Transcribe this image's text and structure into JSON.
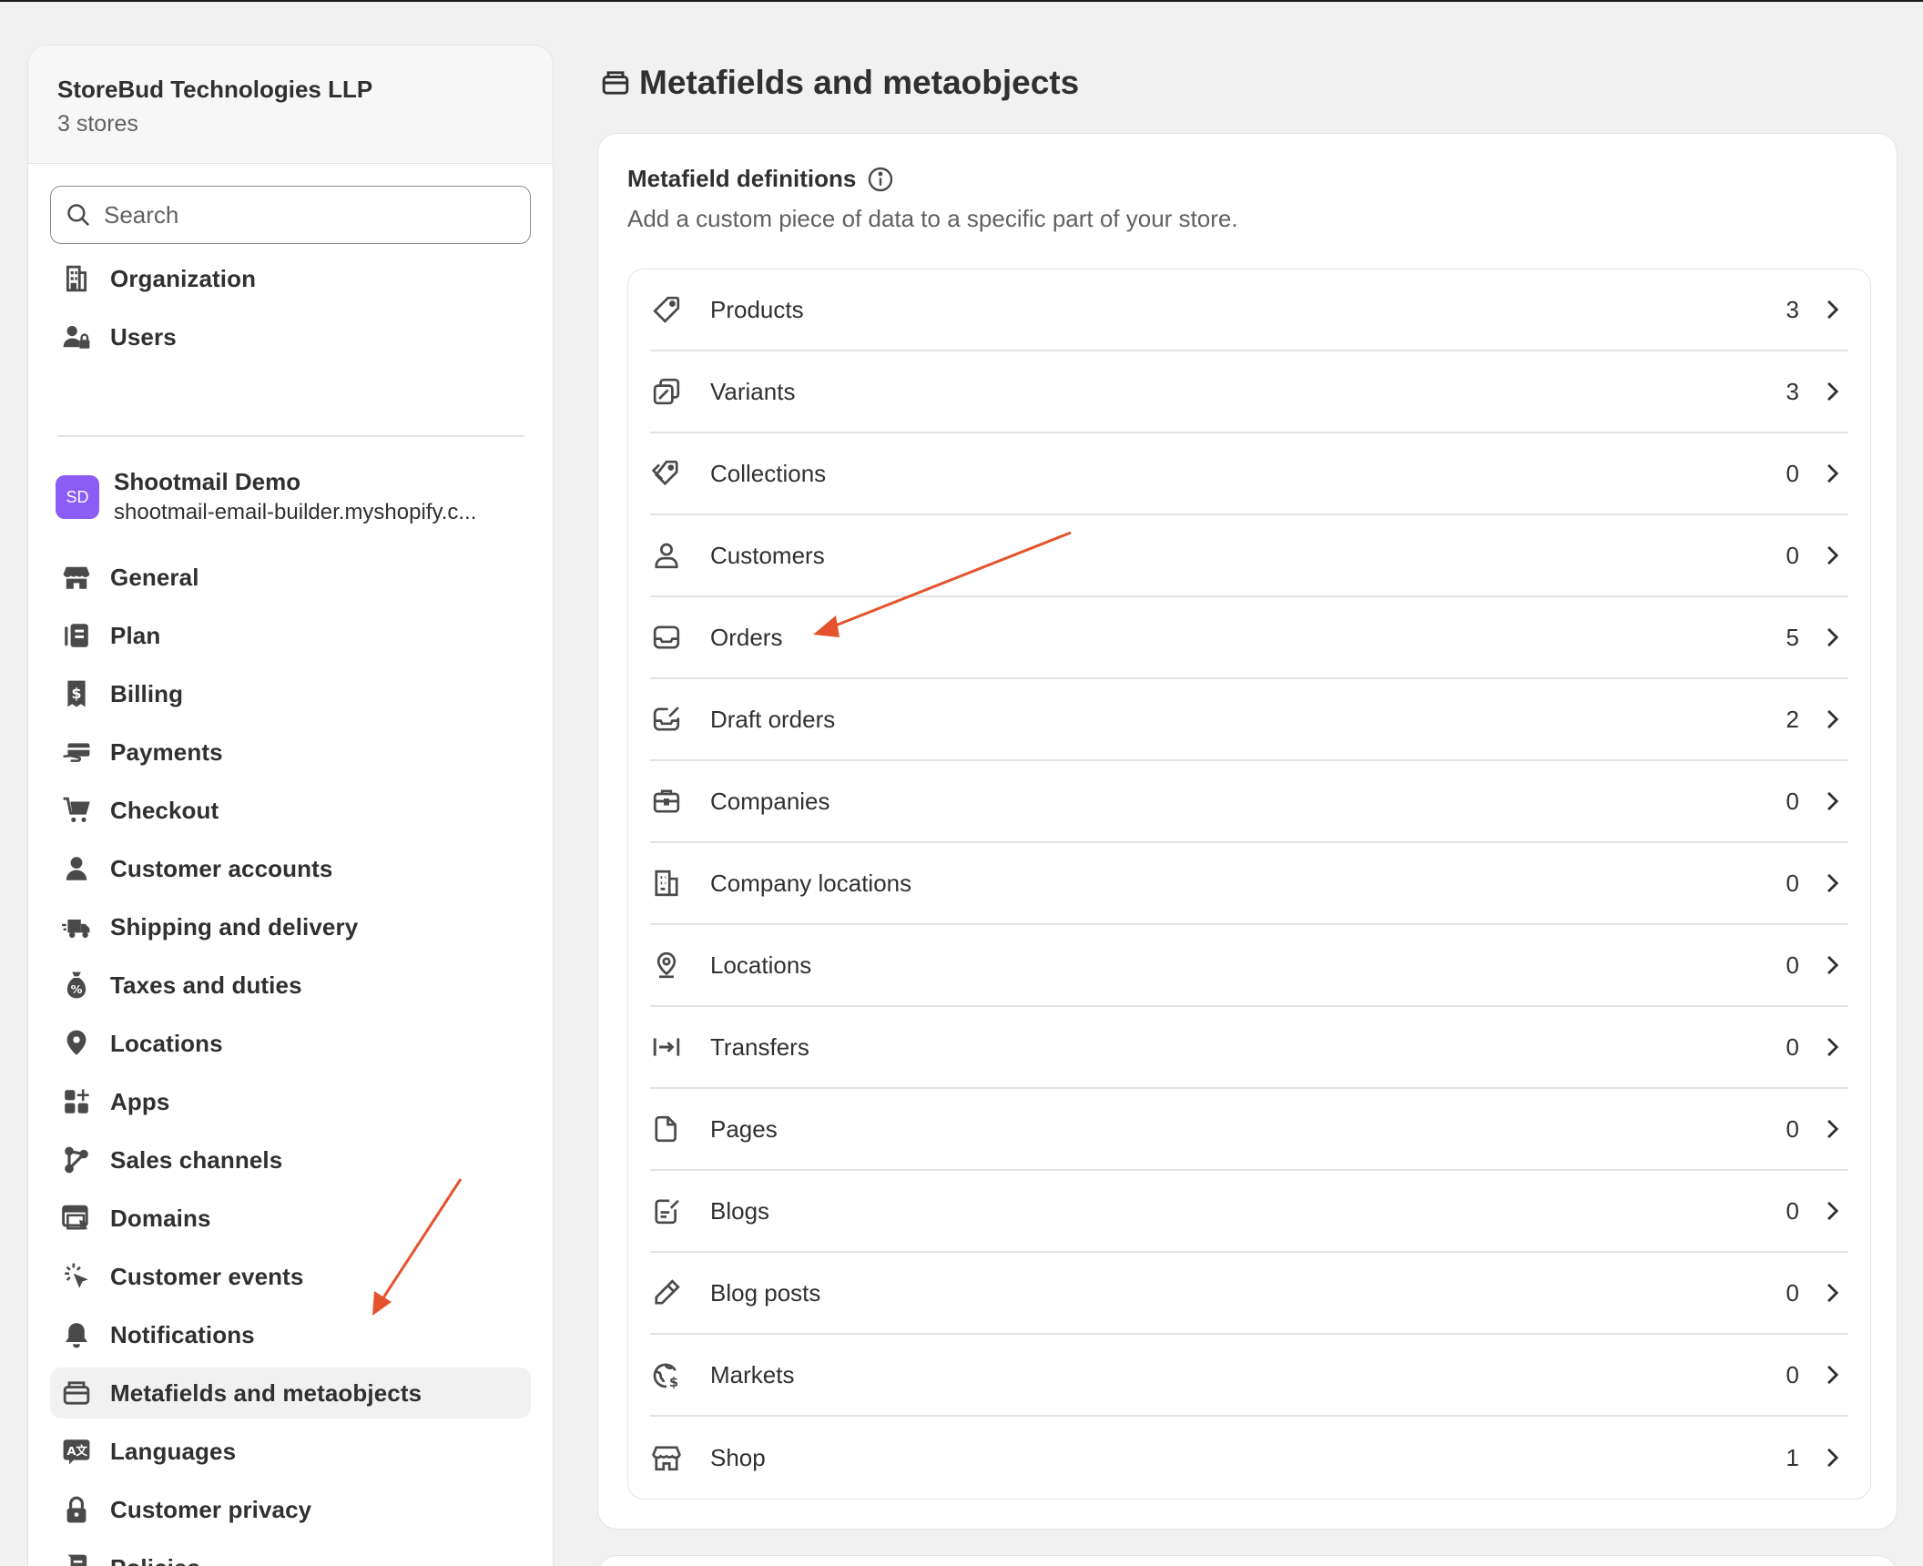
{
  "organization": {
    "name": "StoreBud Technologies LLP",
    "store_count": "3 stores"
  },
  "search": {
    "placeholder": "Search"
  },
  "org_nav": [
    {
      "label": "Organization",
      "icon": "building-icon"
    },
    {
      "label": "Users",
      "icon": "users-icon"
    }
  ],
  "store": {
    "avatar": "SD",
    "name": "Shootmail Demo",
    "domain": "shootmail-email-builder.myshopify.c...",
    "avatar_color": "#8b5cf6"
  },
  "settings_nav": [
    {
      "label": "General",
      "icon": "store-icon"
    },
    {
      "label": "Plan",
      "icon": "plan-icon"
    },
    {
      "label": "Billing",
      "icon": "billing-icon"
    },
    {
      "label": "Payments",
      "icon": "payments-icon"
    },
    {
      "label": "Checkout",
      "icon": "cart-icon"
    },
    {
      "label": "Customer accounts",
      "icon": "person-icon"
    },
    {
      "label": "Shipping and delivery",
      "icon": "truck-icon"
    },
    {
      "label": "Taxes and duties",
      "icon": "tax-icon"
    },
    {
      "label": "Locations",
      "icon": "location-pin-icon"
    },
    {
      "label": "Apps",
      "icon": "apps-icon"
    },
    {
      "label": "Sales channels",
      "icon": "channels-icon"
    },
    {
      "label": "Domains",
      "icon": "domains-icon"
    },
    {
      "label": "Customer events",
      "icon": "cursor-click-icon"
    },
    {
      "label": "Notifications",
      "icon": "bell-icon"
    },
    {
      "label": "Metafields and metaobjects",
      "icon": "metafields-icon",
      "active": true
    },
    {
      "label": "Languages",
      "icon": "language-icon"
    },
    {
      "label": "Customer privacy",
      "icon": "lock-icon"
    },
    {
      "label": "Policies",
      "icon": "policy-icon"
    }
  ],
  "page": {
    "title": "Metafields and metaobjects",
    "section_title": "Metafield definitions",
    "section_description": "Add a custom piece of data to a specific part of your store."
  },
  "definitions": [
    {
      "label": "Products",
      "count": "3",
      "icon": "tag-icon"
    },
    {
      "label": "Variants",
      "count": "3",
      "icon": "variants-icon"
    },
    {
      "label": "Collections",
      "count": "0",
      "icon": "collections-icon"
    },
    {
      "label": "Customers",
      "count": "0",
      "icon": "customer-icon"
    },
    {
      "label": "Orders",
      "count": "5",
      "icon": "inbox-icon"
    },
    {
      "label": "Draft orders",
      "count": "2",
      "icon": "draft-order-icon"
    },
    {
      "label": "Companies",
      "count": "0",
      "icon": "briefcase-icon"
    },
    {
      "label": "Company locations",
      "count": "0",
      "icon": "company-building-icon"
    },
    {
      "label": "Locations",
      "count": "0",
      "icon": "location-icon"
    },
    {
      "label": "Transfers",
      "count": "0",
      "icon": "transfer-icon"
    },
    {
      "label": "Pages",
      "count": "0",
      "icon": "page-icon"
    },
    {
      "label": "Blogs",
      "count": "0",
      "icon": "blog-icon"
    },
    {
      "label": "Blog posts",
      "count": "0",
      "icon": "pencil-icon"
    },
    {
      "label": "Markets",
      "count": "0",
      "icon": "globe-dollar-icon"
    },
    {
      "label": "Shop",
      "count": "1",
      "icon": "shop-icon"
    }
  ],
  "colors": {
    "annotation_arrow": "#e5532d",
    "background": "#f1f1f1",
    "text": "#303030",
    "muted": "#616161"
  }
}
